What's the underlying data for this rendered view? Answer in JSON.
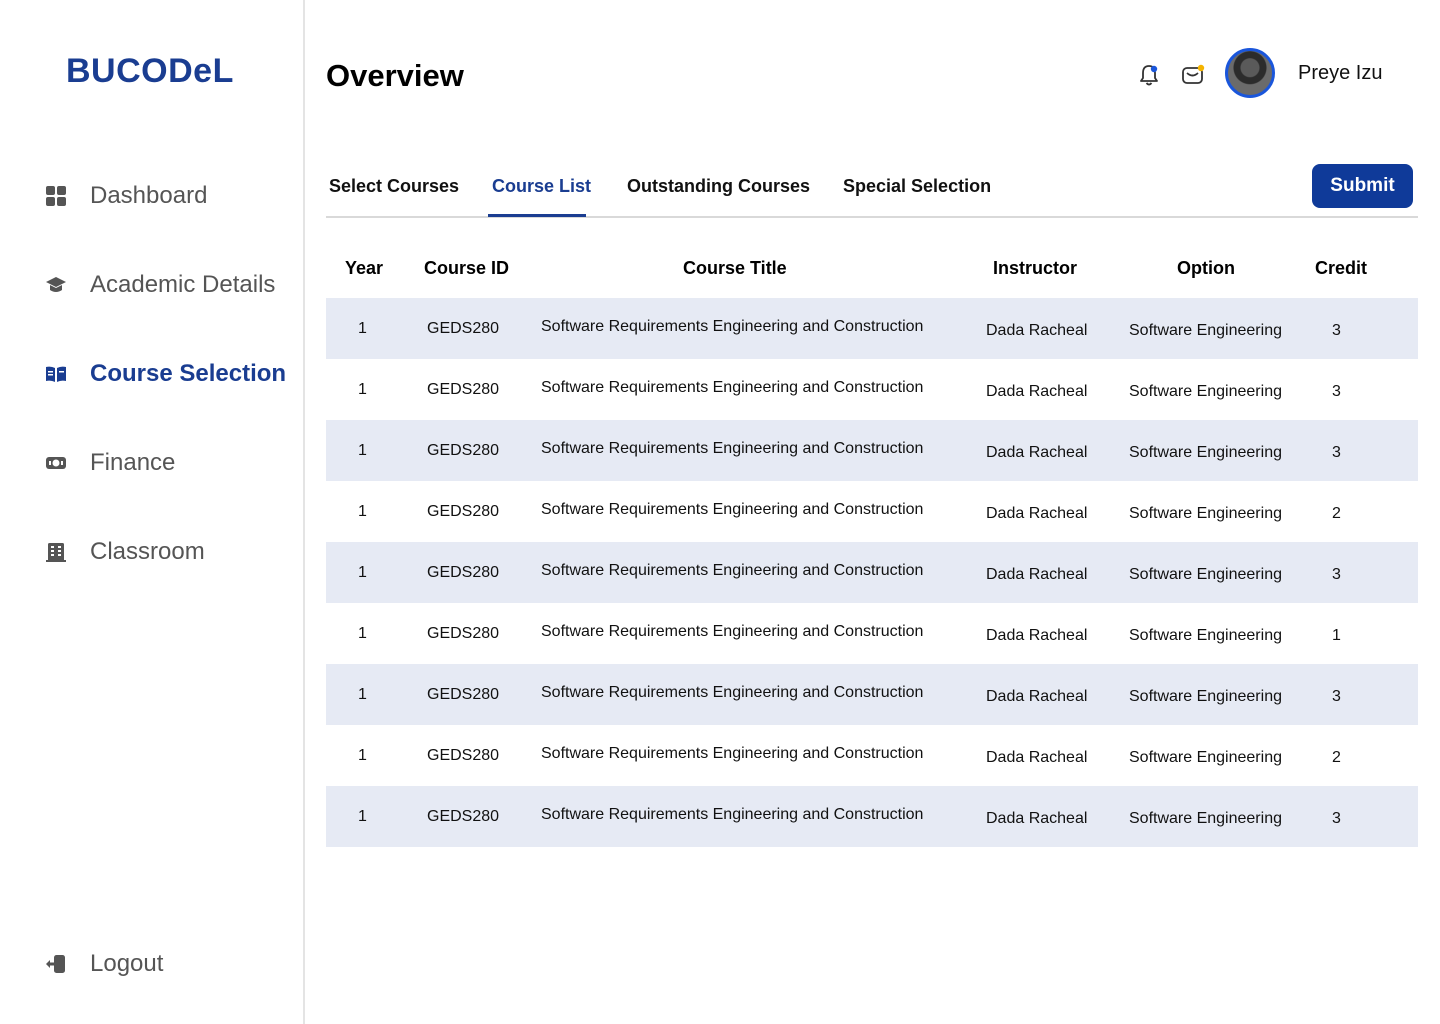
{
  "sidebar": {
    "logo": "BUCODeL",
    "items": [
      {
        "label": "Dashboard",
        "icon": "grid-icon"
      },
      {
        "label": "Academic Details",
        "icon": "graduation-cap-icon"
      },
      {
        "label": "Course Selection",
        "icon": "open-book-icon",
        "active": true
      },
      {
        "label": "Finance",
        "icon": "money-icon"
      },
      {
        "label": "Classroom",
        "icon": "building-icon"
      }
    ],
    "logout": {
      "label": "Logout",
      "icon": "logout-icon"
    }
  },
  "header": {
    "title": "Overview",
    "user_name": "Preye Izu"
  },
  "tabs": [
    {
      "label": "Select Courses"
    },
    {
      "label": "Course List",
      "active": true
    },
    {
      "label": "Outstanding Courses"
    },
    {
      "label": "Special Selection"
    }
  ],
  "submit_label": "Submit",
  "table": {
    "headers": [
      "Year",
      "Course ID",
      "Course Title",
      "Instructor",
      "Option",
      "Credit"
    ],
    "rows": [
      [
        "1",
        "GEDS280",
        "Software Requirements Engineering and Construction",
        "Dada Racheal",
        "Software Engineering",
        "3"
      ],
      [
        "1",
        "GEDS280",
        "Software Requirements Engineering and Construction",
        "Dada Racheal",
        "Software Engineering",
        "3"
      ],
      [
        "1",
        "GEDS280",
        "Software Requirements Engineering and Construction",
        "Dada Racheal",
        "Software Engineering",
        "3"
      ],
      [
        "1",
        "GEDS280",
        "Software Requirements Engineering and Construction",
        "Dada Racheal",
        "Software Engineering",
        "2"
      ],
      [
        "1",
        "GEDS280",
        "Software Requirements Engineering and Construction",
        "Dada Racheal",
        "Software Engineering",
        "3"
      ],
      [
        "1",
        "GEDS280",
        "Software Requirements Engineering and Construction",
        "Dada Racheal",
        "Software Engineering",
        "1"
      ],
      [
        "1",
        "GEDS280",
        "Software Requirements Engineering and Construction",
        "Dada Racheal",
        "Software Engineering",
        "3"
      ],
      [
        "1",
        "GEDS280",
        "Software Requirements Engineering and Construction",
        "Dada Racheal",
        "Software Engineering",
        "2"
      ],
      [
        "1",
        "GEDS280",
        "Software Requirements Engineering and Construction",
        "Dada Racheal",
        "Software Engineering",
        "3"
      ]
    ]
  },
  "colors": {
    "brand": "#1a3d91",
    "row_shade": "#e6eaf4",
    "button": "#0f3a99",
    "notification_dot": "#1a56db",
    "mail_dot": "#f5b400"
  }
}
